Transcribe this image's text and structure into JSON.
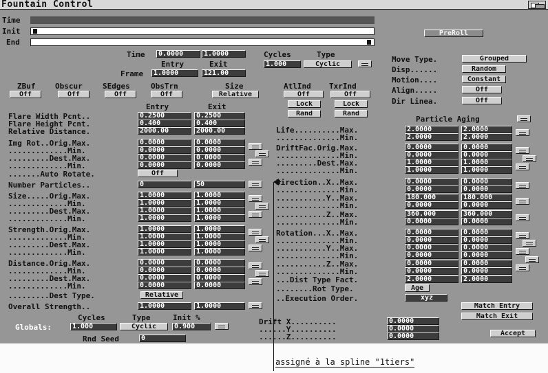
{
  "window_title": "Fountain Control",
  "timeline": {
    "time_label": "Time",
    "init_label": "Init",
    "end_label": "End"
  },
  "preroll_label": "PreRoll",
  "time_panel": {
    "time_label": "Time",
    "time_entry": "0.0000",
    "time_exit": "1.0000",
    "entry_label": "Entry",
    "exit_label": "Exit",
    "frame_label": "Frame",
    "frame_entry": "1.0000",
    "frame_exit": "121.00",
    "cycles_label": "Cycles",
    "type_label": "Type",
    "cycles_value": "1.000",
    "type_value": "Cyclic"
  },
  "move_panel": {
    "move_type_label": "Move Type.",
    "move_type_value": "Grouped",
    "disp_label": "Disp......",
    "disp_value": "Random",
    "motion_label": "Motion....",
    "motion_value": "Constant",
    "align_label": "Align.....",
    "align_value": "Off",
    "dir_label": "Dir Linea.",
    "dir_value": "Off"
  },
  "toggles": [
    {
      "label": "ZBuf",
      "value": "Off"
    },
    {
      "label": "Obscur",
      "value": "Off"
    },
    {
      "label": "SEdges",
      "value": "Off"
    },
    {
      "label": "ObsTrn",
      "value": "Off"
    },
    {
      "label": "Size",
      "value": "Relative"
    }
  ],
  "atl_panel": {
    "atlind_label": "AtlInd",
    "txrind_label": "TxrInd",
    "atlind_value": "Off",
    "txrind_value": "Off",
    "lock1": "Lock",
    "lock2": "Lock",
    "rand1": "Rand",
    "rand2": "Rand"
  },
  "left_header": {
    "entry": "Entry",
    "exit": "Exit"
  },
  "left_rows": {
    "flare_width": {
      "label": "Flare Width Pcnt..",
      "entry": "0.2500",
      "exit": "0.2500"
    },
    "flare_height": {
      "label": "Flare Height Pcnt.",
      "entry": "0.400",
      "exit": "0.400"
    },
    "rel_distance": {
      "label": "Relative Distance.",
      "entry": "2000.00",
      "exit": "2000.00"
    },
    "img_rot": [
      {
        "label": "Img Rot..Orig.Max.",
        "entry": "0.0000",
        "exit": "0.0000"
      },
      {
        "label": ".............Min.",
        "entry": "0.0000",
        "exit": "0.0000"
      },
      {
        "label": ".........Dest.Max.",
        "entry": "0.0000",
        "exit": "0.0000"
      },
      {
        "label": ".............Min.",
        "entry": "0.0000",
        "exit": "0.0000"
      }
    ],
    "auto_rotate": {
      "label": ".......Auto Rotate.",
      "value": "Off"
    },
    "num_particles": {
      "label": "Number Particles..",
      "entry": "0",
      "exit": "50"
    },
    "size": [
      {
        "label": "Size.....Orig.Max.",
        "entry": "1.0000",
        "exit": "1.0000"
      },
      {
        "label": ".............Min.",
        "entry": "1.0000",
        "exit": "1.0000"
      },
      {
        "label": ".........Dest.Max.",
        "entry": "1.0000",
        "exit": "1.0000"
      },
      {
        "label": ".............Min.",
        "entry": "1.0000",
        "exit": "1.0000"
      }
    ],
    "strength": [
      {
        "label": "Strength.Orig.Max.",
        "entry": "1.0000",
        "exit": "1.0000"
      },
      {
        "label": ".............Min.",
        "entry": "1.0000",
        "exit": "1.0000"
      },
      {
        "label": ".........Dest.Max.",
        "entry": "1.0000",
        "exit": "1.0000"
      },
      {
        "label": ".............Min.",
        "entry": "1.0000",
        "exit": "1.0000"
      }
    ],
    "distance": [
      {
        "label": "Distance.Orig.Max.",
        "entry": "0.0000",
        "exit": "0.0000"
      },
      {
        "label": ".............Min.",
        "entry": "0.0000",
        "exit": "0.0000"
      },
      {
        "label": ".........Dest.Max.",
        "entry": "0.0000",
        "exit": "0.0000"
      },
      {
        "label": ".............Min.",
        "entry": "0.0000",
        "exit": "0.0000"
      }
    ],
    "dest_type": {
      "label": ".........Dest Type.",
      "value": "Relative"
    },
    "overall_strength": {
      "label": "Overall Strength..",
      "entry": "1.0000",
      "exit": "1.0000"
    }
  },
  "globals": {
    "label": "Globals:",
    "cycles_label": "Cycles",
    "type_label": "Type",
    "init_label": "Init %",
    "cycles_value": "1.000",
    "type_value": "Cyclic",
    "init_value": "0.900",
    "rnd_seed_label": "Rnd Seed",
    "rnd_seed_value": "0"
  },
  "right_header": "Particle Aging",
  "right_rows": {
    "life": [
      {
        "label": "Life..........Max.",
        "a": "2.0000",
        "b": "2.0000"
      },
      {
        "label": "..............Min.",
        "a": "2.0000",
        "b": "2.0000"
      }
    ],
    "drift": [
      {
        "label": "DriftFac.Orig.Max.",
        "a": "0.0000",
        "b": "0.0000"
      },
      {
        "label": "..............Min.",
        "a": "0.0000",
        "b": "0.0000"
      },
      {
        "label": ".........Dest.Max.",
        "a": "1.0000",
        "b": "1.0000"
      },
      {
        "label": "..............Min.",
        "a": "1.0000",
        "b": "1.0000"
      }
    ],
    "direction": [
      {
        "label": "Direction..X..Max.",
        "a": "0.0000",
        "b": "0.0000"
      },
      {
        "label": "..............Min.",
        "a": "0.0000",
        "b": "0.0000"
      },
      {
        "label": "...........Y..Max.",
        "a": "180.000",
        "b": "180.000"
      },
      {
        "label": "..............Min.",
        "a": "0.0000",
        "b": "0.0000"
      },
      {
        "label": "...........Z..Max.",
        "a": "360.000",
        "b": "360.000"
      },
      {
        "label": "..............Min.",
        "a": "0.0000",
        "b": "0.0000"
      }
    ],
    "rotation": [
      {
        "label": "Rotation...X..Max.",
        "a": "0.0000",
        "b": "0.0000"
      },
      {
        "label": "..............Min.",
        "a": "0.0000",
        "b": "0.0000"
      },
      {
        "label": "...........Y..Max.",
        "a": "0.0000",
        "b": "0.0000"
      },
      {
        "label": "..............Min.",
        "a": "0.0000",
        "b": "0.0000"
      },
      {
        "label": "...........Z..Max.",
        "a": "0.0000",
        "b": "0.0000"
      },
      {
        "label": "..............Min.",
        "a": "0.0000",
        "b": "0.0000"
      }
    ],
    "dist_type_fact": {
      "label": "...Dist Type Fact.",
      "a": "2.0000",
      "b": "2.0000"
    },
    "rot_type": {
      "label": "........Rot Type.",
      "value": "Age"
    },
    "exec_order": {
      "label": "..Execution Order.",
      "value": "xyz"
    }
  },
  "drift_xyz": [
    {
      "label": "Drift X..........",
      "value": "0.0000"
    },
    {
      "label": "......Y..........",
      "value": "0.0000"
    },
    {
      "label": "......Z..........",
      "value": "0.0000"
    }
  ],
  "buttons": {
    "match_entry": "Match Entry",
    "match_exit": "Match Exit",
    "accept": "Accept"
  },
  "annotation": "assigné à la spline \"1tiers\"",
  "colors": {
    "window_bg": "#969696",
    "field_bg": "#3c3c3c",
    "button_bg": "#cfcfcf",
    "page_bg": "#ffffff"
  }
}
